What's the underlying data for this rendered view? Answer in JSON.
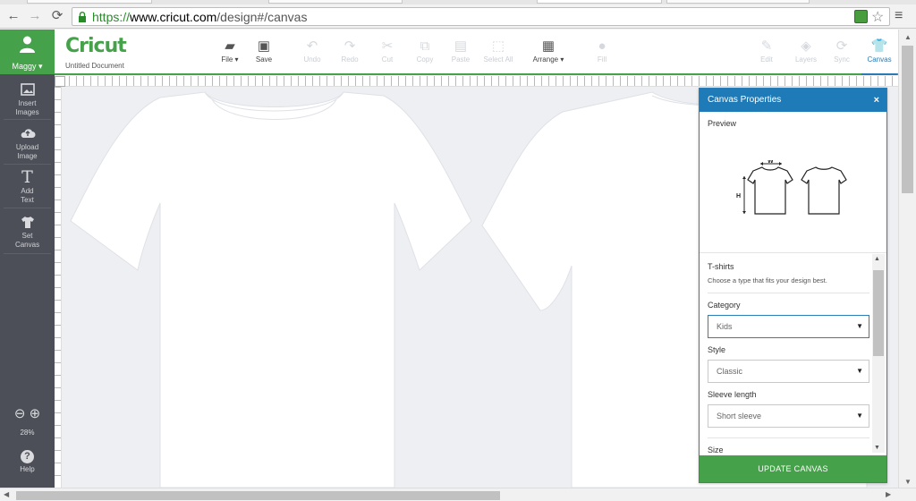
{
  "browser": {
    "url_scheme": "https://",
    "url_host": "www.cricut.com",
    "url_path": "/design#/canvas",
    "back_icon": "arrow-left-icon",
    "forward_icon": "arrow-right-icon",
    "reload_icon": "reload-icon",
    "bookmark_icon": "star-icon",
    "menu_icon": "hamburger-icon"
  },
  "user": {
    "name": "Maggy ▾"
  },
  "sidebar": {
    "items": [
      {
        "line1": "Insert",
        "line2": "Images",
        "icon": "image-icon"
      },
      {
        "line1": "Upload",
        "line2": "Image",
        "icon": "cloud-upload-icon"
      },
      {
        "line1": "Add",
        "line2": "Text",
        "icon": "text-icon"
      },
      {
        "line1": "Set",
        "line2": "Canvas",
        "icon": "tshirt-icon"
      }
    ],
    "zoom_level": "28%",
    "help_label": "Help"
  },
  "toolbar": {
    "logo": "Cricut",
    "document_name": "Untitled Document",
    "tools": [
      {
        "label": "File ▾",
        "glyph": "▰",
        "state": "enabled"
      },
      {
        "label": "Save",
        "glyph": "▣",
        "state": "enabled"
      },
      {
        "label": "Undo",
        "glyph": "↶",
        "state": "disabled"
      },
      {
        "label": "Redo",
        "glyph": "↷",
        "state": "disabled"
      },
      {
        "label": "Cut",
        "glyph": "✂",
        "state": "disabled"
      },
      {
        "label": "Copy",
        "glyph": "⧉",
        "state": "disabled"
      },
      {
        "label": "Paste",
        "glyph": "▤",
        "state": "disabled"
      },
      {
        "label": "Select All",
        "glyph": "⬚",
        "state": "disabled"
      },
      {
        "label": "Arrange ▾",
        "glyph": "▦",
        "state": "enabled"
      },
      {
        "label": "Fill",
        "glyph": "●",
        "state": "disabled"
      },
      {
        "label": "Edit",
        "glyph": "✎",
        "state": "disabled"
      },
      {
        "label": "Layers",
        "glyph": "◈",
        "state": "disabled"
      },
      {
        "label": "Sync",
        "glyph": "⟳",
        "state": "disabled"
      },
      {
        "label": "Canvas",
        "glyph": "👕",
        "state": "active"
      }
    ]
  },
  "panel": {
    "title": "Canvas Properties",
    "close": "×",
    "preview_label": "Preview",
    "diagram_w": "W",
    "diagram_h": "H",
    "section_title": "T-shirts",
    "section_hint": "Choose a type that fits your design best.",
    "category_label": "Category",
    "category_value": "Kids",
    "style_label": "Style",
    "style_value": "Classic",
    "sleeve_label": "Sleeve length",
    "sleeve_value": "Short sleeve",
    "size_label": "Size",
    "update_button": "UPDATE CANVAS"
  }
}
